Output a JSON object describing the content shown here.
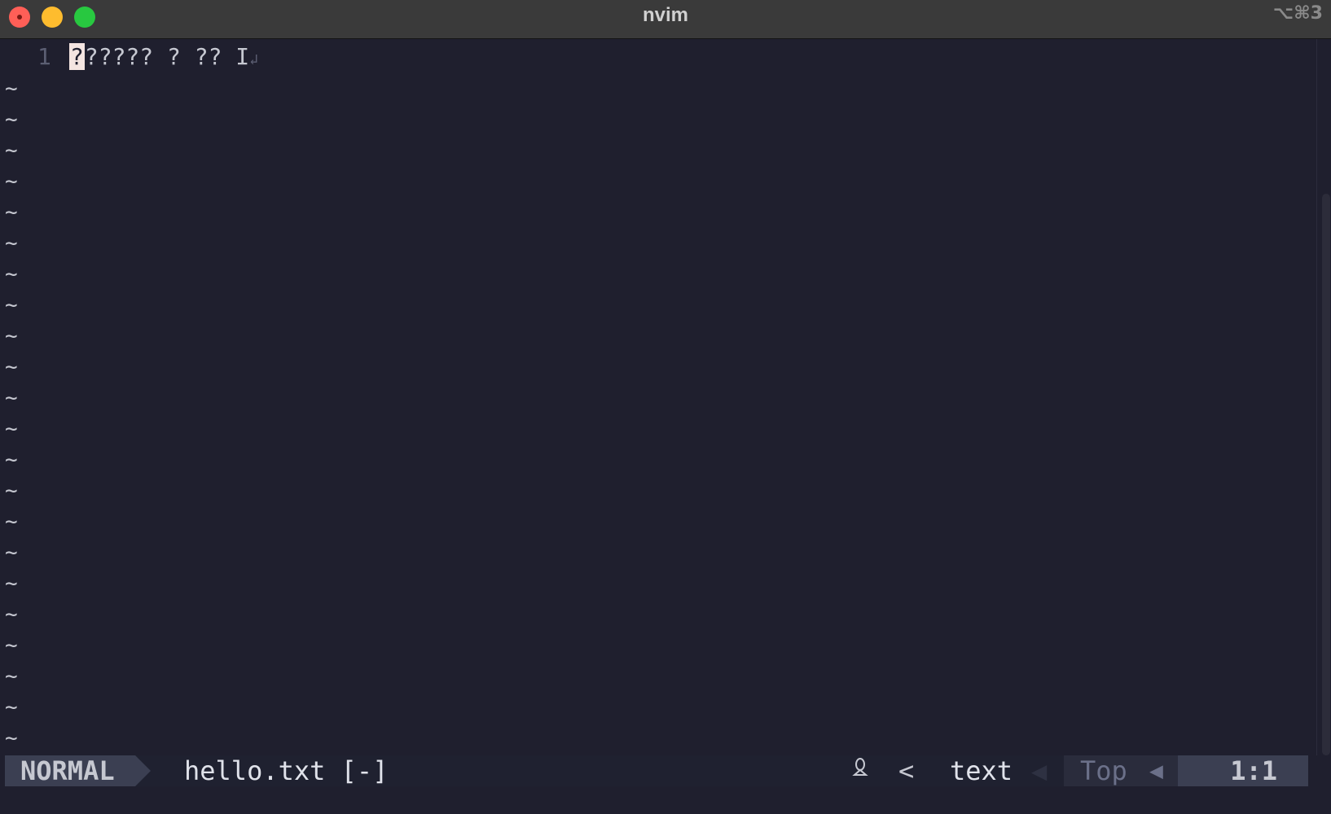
{
  "window": {
    "title": "nvim",
    "shortcut": "⌥⌘3"
  },
  "editor": {
    "lines": [
      {
        "number": "1",
        "cursor_char": "?",
        "text": "????? ? ?? I",
        "eol": "↲"
      }
    ],
    "tilde": "~"
  },
  "statusline": {
    "mode": "NORMAL",
    "filename": "hello.txt [-]",
    "os_icon": "linux-icon",
    "separator": "<",
    "filetype": "text",
    "position": "Top",
    "cursor": "1:1"
  },
  "colors": {
    "background": "#1f1f2e",
    "titlebar": "#3a3a3a",
    "cursor": "#f4e5e1",
    "mode_bg": "#3b3f52"
  }
}
